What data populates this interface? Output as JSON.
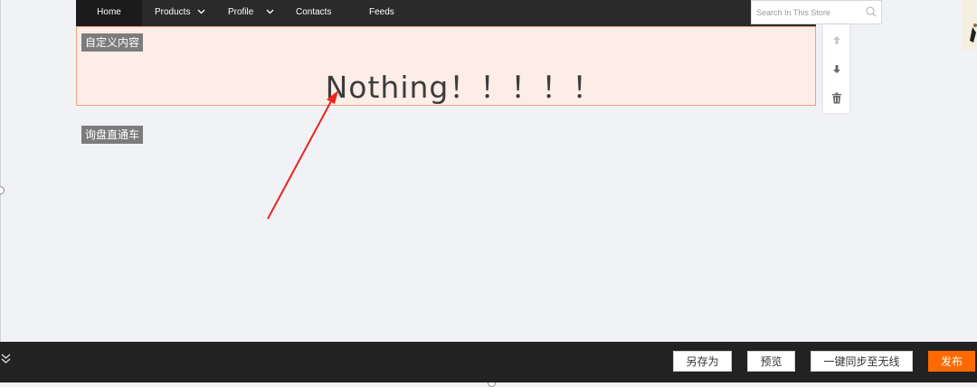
{
  "nav": {
    "items": [
      {
        "label": "Home",
        "active": true,
        "dropdown": false
      },
      {
        "label": "Products",
        "active": false,
        "dropdown": true
      },
      {
        "label": "Profile",
        "active": false,
        "dropdown": true
      },
      {
        "label": "Contacts",
        "active": false,
        "dropdown": false
      },
      {
        "label": "Feeds",
        "active": false,
        "dropdown": false
      }
    ],
    "search_placeholder": "Search In This Store",
    "search_icon": "search-icon"
  },
  "module": {
    "tag": "自定义内容",
    "content": "Nothing！！！！！"
  },
  "module2": {
    "tag": "询盘直通车"
  },
  "side_tools": [
    "arrow-up-icon",
    "arrow-down-icon",
    "trash-icon"
  ],
  "bottom": {
    "buttons": {
      "save_as": "另存为",
      "preview": "预览",
      "sync_mobile": "一键同步至无线",
      "publish": "发布"
    }
  },
  "colors": {
    "nav_bg": "#2a2a2a",
    "module_bg": "#fcede6",
    "module_border": "#f0a37a",
    "publish": "#ff6a00",
    "annotation_arrow": "#ee2222"
  }
}
